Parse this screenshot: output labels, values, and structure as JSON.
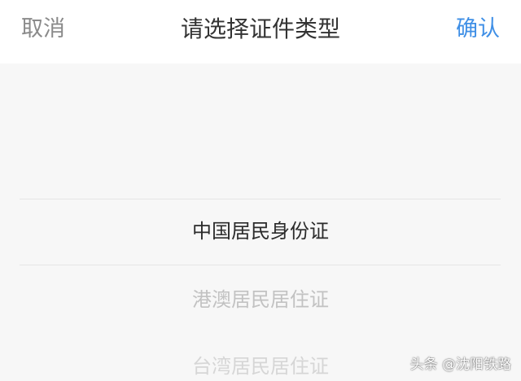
{
  "header": {
    "cancel_label": "取消",
    "title": "请选择证件类型",
    "confirm_label": "确认"
  },
  "picker": {
    "options": [
      "中国居民身份证",
      "港澳居民居住证",
      "台湾居民居住证"
    ],
    "selected_index": 0
  },
  "watermark": "头条 @沈阳铁路",
  "colors": {
    "accent": "#3f8fe6",
    "cancel": "#8a8a8a",
    "title": "#333333",
    "selected_text": "#2b2b2b",
    "faded_text": "#c2c2c2",
    "background": "#f7f7f7"
  }
}
